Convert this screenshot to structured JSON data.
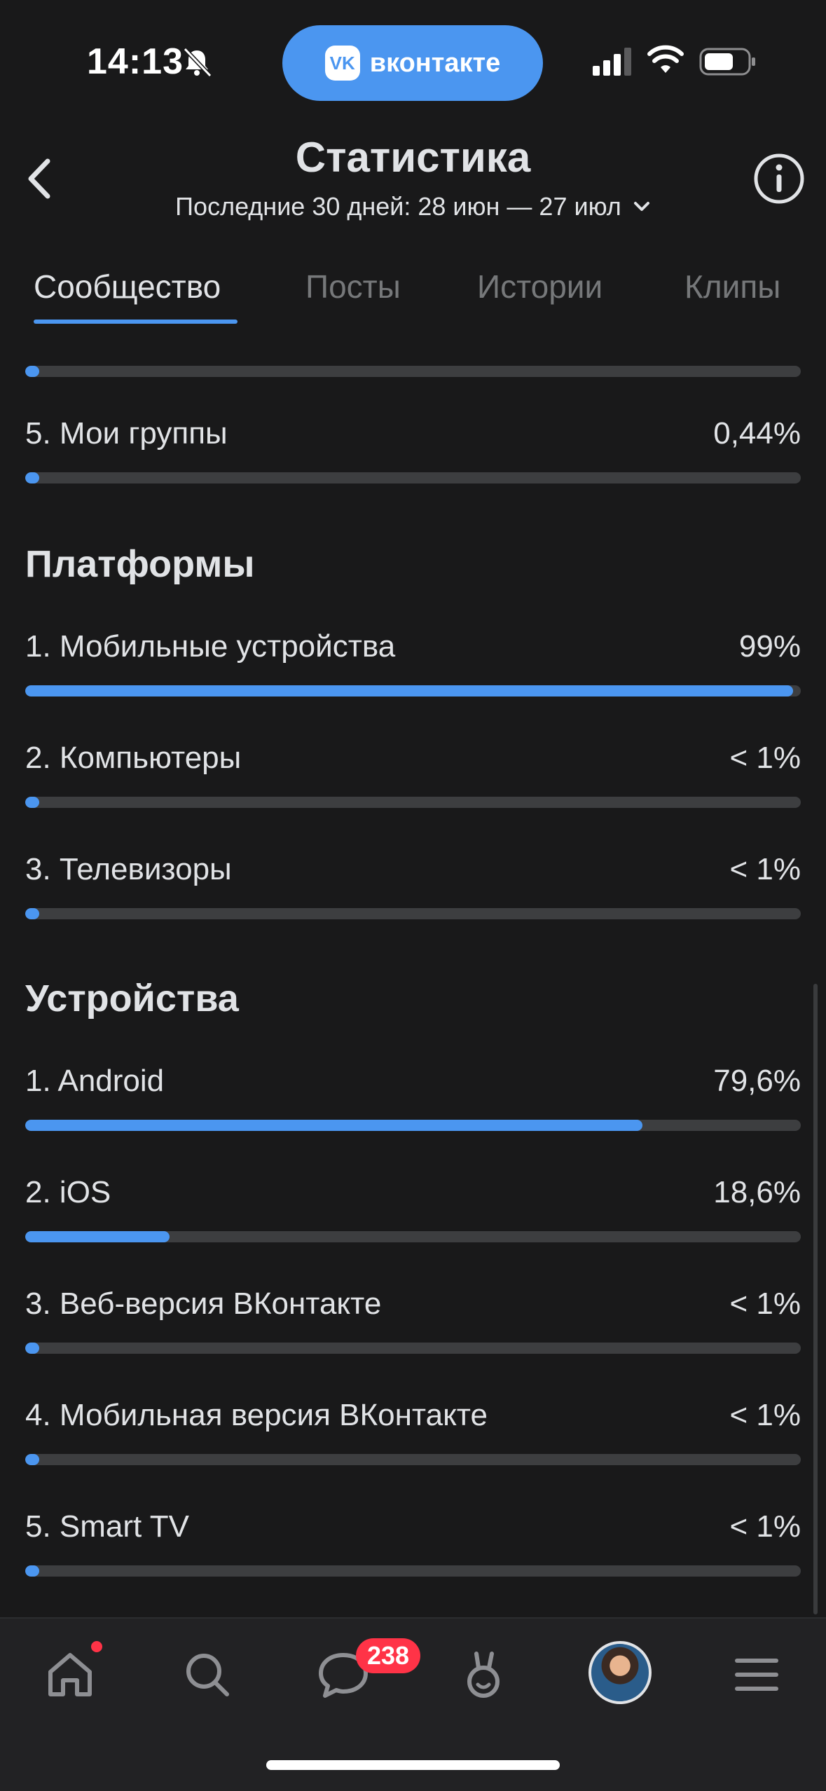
{
  "status_bar": {
    "time": "14:13",
    "app_pill_label": "вконтакте",
    "app_logo": "VK",
    "icons": [
      "bell-slash-icon",
      "signal-icon",
      "wifi-icon",
      "battery-icon"
    ]
  },
  "header": {
    "title": "Статистика",
    "period": "Последние 30 дней: 28 июн — 27 июл",
    "icons": [
      "chevron-left-icon",
      "info-icon",
      "chevron-down-icon"
    ]
  },
  "tabs": [
    {
      "label": "Сообщество",
      "active": true
    },
    {
      "label": "Посты",
      "active": false
    },
    {
      "label": "Истории",
      "active": false
    },
    {
      "label": "Клипы",
      "active": false
    }
  ],
  "partial_top_row": {
    "fraction": 0.004
  },
  "previous_section_last": {
    "label": "5. Мои группы",
    "value": "0,44%",
    "fraction": 0.0044
  },
  "platforms": {
    "title": "Платформы",
    "items": [
      {
        "label": "1. Мобильные устройства",
        "value": "99%",
        "fraction": 0.99
      },
      {
        "label": "2. Компьютеры",
        "value": "< 1%",
        "fraction": 0.005
      },
      {
        "label": "3. Телевизоры",
        "value": "< 1%",
        "fraction": 0.005
      }
    ]
  },
  "devices": {
    "title": "Устройства",
    "items": [
      {
        "label": "1. Android",
        "value": "79,6%",
        "fraction": 0.796
      },
      {
        "label": "2. iOS",
        "value": "18,6%",
        "fraction": 0.186
      },
      {
        "label": "3. Веб-версия ВКонтакте",
        "value": "< 1%",
        "fraction": 0.005
      },
      {
        "label": "4. Мобильная версия ВКонтакте",
        "value": "< 1%",
        "fraction": 0.005
      },
      {
        "label": "5. Smart TV",
        "value": "< 1%",
        "fraction": 0.005
      }
    ]
  },
  "tab_bar": {
    "items": [
      "home-icon",
      "search-icon",
      "messages-icon",
      "clips-icon",
      "profile-avatar",
      "menu-icon"
    ],
    "messages_badge": "238"
  },
  "colors": {
    "accent": "#4b96f0",
    "background": "#19191a",
    "track": "#3d3e40",
    "badge": "#ff3347"
  }
}
